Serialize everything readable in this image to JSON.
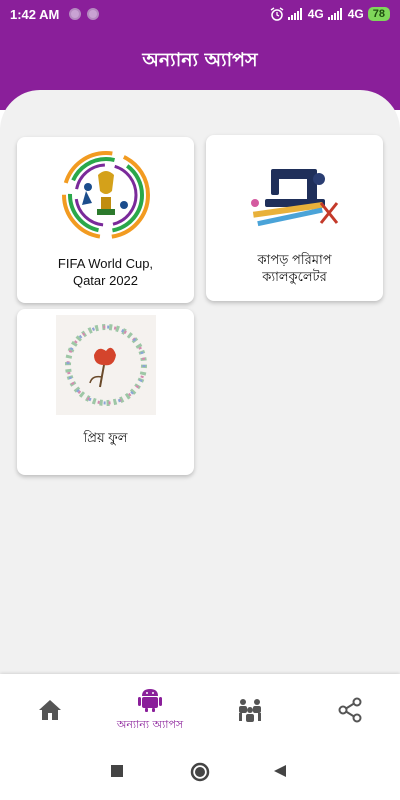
{
  "status_bar": {
    "time": "1:42 AM",
    "network_1": "4G",
    "network_2": "4G",
    "battery": "78"
  },
  "app_bar": {
    "title": "অন্যান্য অ্যাপস"
  },
  "apps": [
    {
      "name": "FIFA World Cup,\nQatar 2022",
      "line1": "FIFA World Cup,",
      "line2": "Qatar 2022",
      "icon": "world-cup-trophy"
    },
    {
      "name": "কাপড় পরিমাপ ক্যালকুলেটর",
      "line1": "কাপড় পরিমাপ",
      "line2": "ক্যালকুলেটর",
      "icon": "sewing-machine"
    },
    {
      "name": "প্রিয় ফুল",
      "line1": "প্রিয় ফুল",
      "line2": "",
      "icon": "flower-wreath"
    }
  ],
  "bottom_nav": {
    "items": [
      {
        "icon": "home-icon",
        "label": ""
      },
      {
        "icon": "android-icon",
        "label": "অন্যান্য অ্যাপস",
        "active": true
      },
      {
        "icon": "people-icon",
        "label": ""
      },
      {
        "icon": "share-icon",
        "label": ""
      }
    ],
    "active_color": "#8a1f9a",
    "inactive_color": "#555555"
  },
  "colors": {
    "primary": "#8a1f9a",
    "background": "#f1f1f1"
  }
}
